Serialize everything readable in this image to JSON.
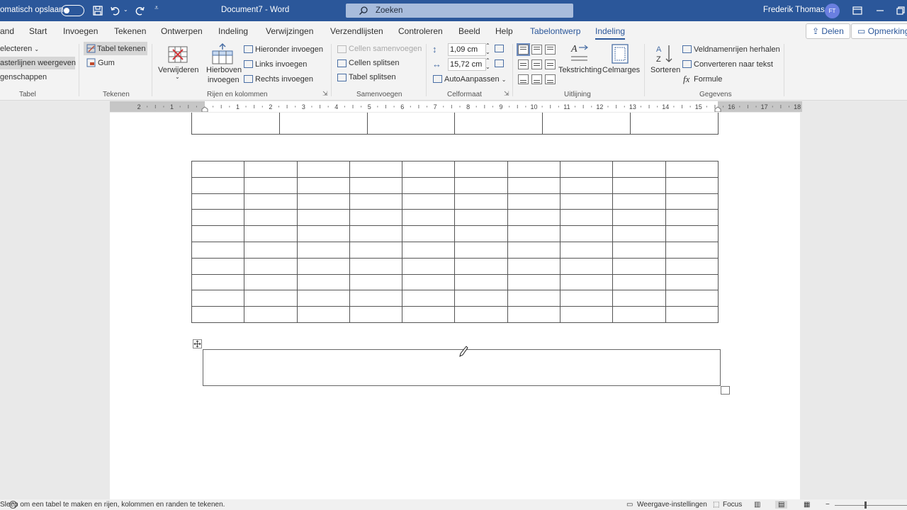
{
  "titlebar": {
    "autosave_label": "omatisch opslaan",
    "document_title": "Document7  -  Word",
    "search_placeholder": "Zoeken",
    "user_name": "Frederik Thomas",
    "user_initials": "FT"
  },
  "tabs": {
    "file": "and",
    "start": "Start",
    "invoegen": "Invoegen",
    "tekenen": "Tekenen",
    "ontwerpen": "Ontwerpen",
    "indeling": "Indeling",
    "verwijzingen": "Verwijzingen",
    "verzendlijsten": "Verzendlijsten",
    "controleren": "Controleren",
    "beeld": "Beeld",
    "help": "Help",
    "tabelontwerp": "Tabelontwerp",
    "indeling_active": "Indeling"
  },
  "share_label": "Delen",
  "comments_label": "Opmerking",
  "ribbon": {
    "tabel": {
      "selecteren": "electeren",
      "rasterlijnen": "asterlijnen weergeven",
      "eigenschappen": "genschappen",
      "group": "Tabel"
    },
    "tekenen": {
      "tabel_tekenen": "Tabel tekenen",
      "gum": "Gum",
      "group": "Tekenen"
    },
    "rijen": {
      "verwijderen": "Verwijderen",
      "hierboven_1": "Hierboven",
      "hierboven_2": "invoegen",
      "hieronder": "Hieronder invoegen",
      "links": "Links invoegen",
      "rechts": "Rechts invoegen",
      "group": "Rijen en kolommen"
    },
    "samenvoegen": {
      "cellen_samenvoegen": "Cellen samenvoegen",
      "cellen_splitsen": "Cellen splitsen",
      "tabel_splitsen": "Tabel splitsen",
      "group": "Samenvoegen"
    },
    "celformaat": {
      "height": "1,09 cm",
      "width": "15,72 cm",
      "autofit": "AutoAanpassen",
      "group": "Celformaat"
    },
    "uitlijning": {
      "tekstrichting": "Tekstrichting",
      "celmarges": "Celmarges",
      "group": "Uitlijning"
    },
    "gegevens": {
      "sorteren": "Sorteren",
      "veldnamenrijen": "Veldnamenrijen herhalen",
      "converteren": "Converteren naar tekst",
      "formule": "Formule",
      "formule_icon": "fx",
      "group": "Gegevens"
    }
  },
  "ruler_labels": [
    "2",
    "1",
    "",
    "1",
    "2",
    "3",
    "4",
    "5",
    "6",
    "7",
    "8",
    "9",
    "10",
    "11",
    "12",
    "13",
    "14",
    "15",
    "16",
    "17",
    "18"
  ],
  "document": {
    "table1_cols": 6,
    "table2_cols": 10,
    "table2_rows": 10
  },
  "statusbar": {
    "hint": "Sleep om een tabel te maken en rijen, kolommen en randen te tekenen.",
    "display_settings": "Weergave-instellingen",
    "focus": "Focus"
  }
}
